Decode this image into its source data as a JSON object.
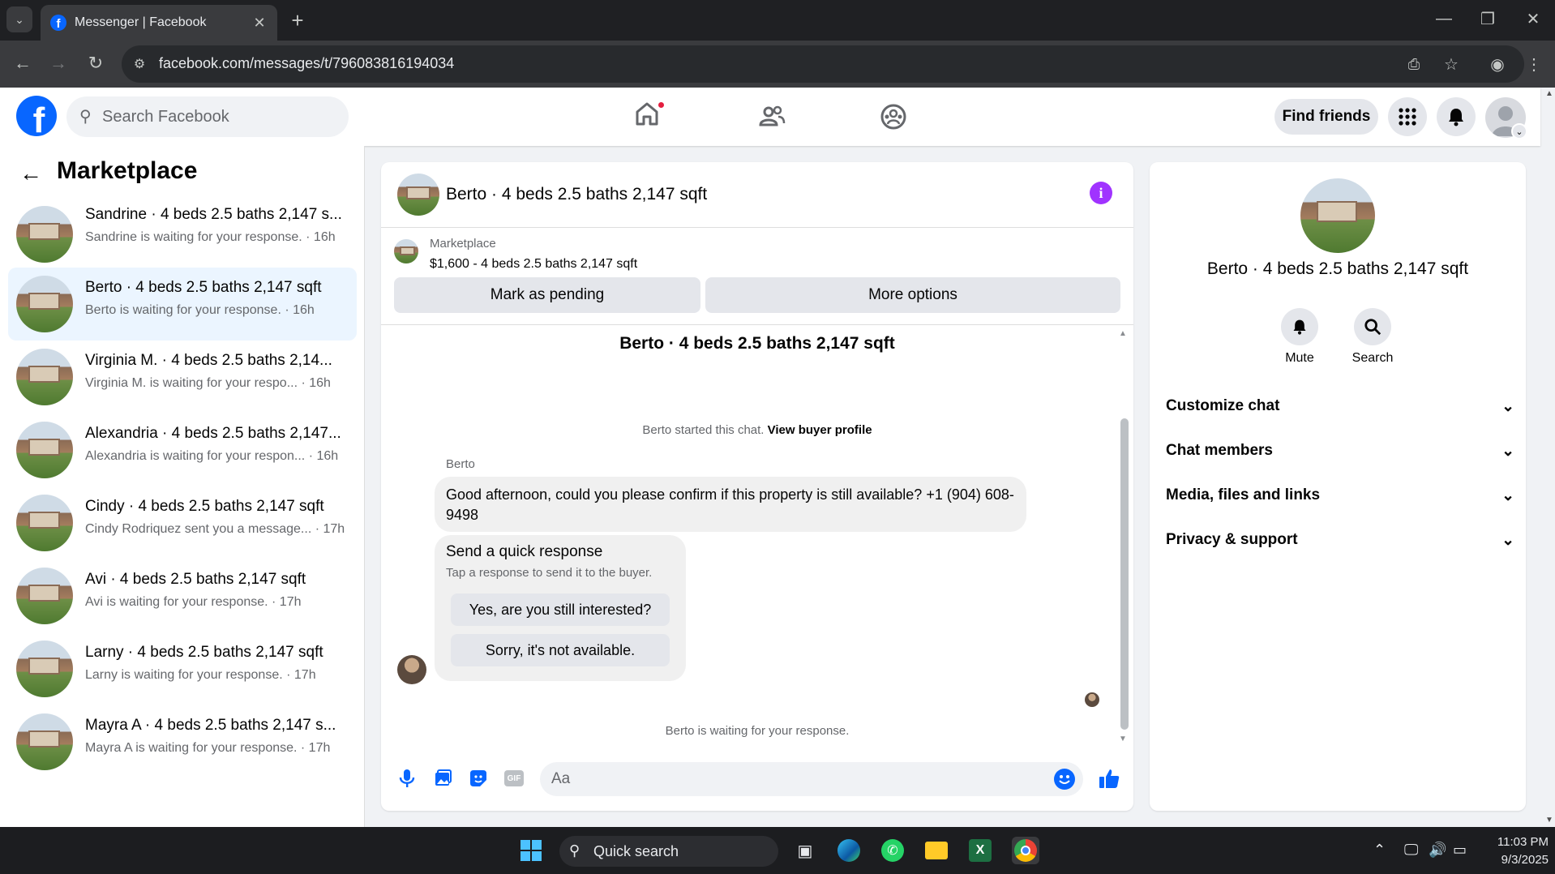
{
  "browser": {
    "tab_title": "Messenger | Facebook",
    "url": "facebook.com/messages/t/796083816194034"
  },
  "header": {
    "search_placeholder": "Search Facebook",
    "find_friends": "Find friends"
  },
  "sidebar": {
    "title": "Marketplace",
    "items": [
      {
        "name": "Sandrine · 4 beds 2.5 baths 2,147 s...",
        "preview": "Sandrine is waiting for your response. · 16h",
        "selected": false
      },
      {
        "name": "Berto · 4 beds 2.5 baths 2,147 sqft",
        "preview": "Berto is waiting for your response. · 16h",
        "selected": true
      },
      {
        "name": "Virginia M. · 4 beds 2.5 baths 2,14...",
        "preview": "Virginia M. is waiting for your respo... · 16h",
        "selected": false
      },
      {
        "name": "Alexandria · 4 beds 2.5 baths 2,147...",
        "preview": "Alexandria is waiting for your respon... · 16h",
        "selected": false
      },
      {
        "name": "Cindy · 4 beds 2.5 baths 2,147 sqft",
        "preview": "Cindy Rodriquez sent you a message... · 17h",
        "selected": false
      },
      {
        "name": "Avi · 4 beds 2.5 baths 2,147 sqft",
        "preview": "Avi is waiting for your response. · 17h",
        "selected": false
      },
      {
        "name": "Larny · 4 beds 2.5 baths 2,147 sqft",
        "preview": "Larny is waiting for your response. · 17h",
        "selected": false
      },
      {
        "name": "Mayra A · 4 beds 2.5 baths 2,147 s...",
        "preview": "Mayra A is waiting for your response. · 17h",
        "selected": false
      }
    ]
  },
  "chat": {
    "title": "Berto · 4 beds 2.5 baths 2,147 sqft",
    "listing_source": "Marketplace",
    "listing_price": "$1,600 - 4 beds 2.5 baths 2,147 sqft",
    "mark_pending": "Mark as pending",
    "more_options": "More options",
    "intro_title": "Berto · 4 beds 2.5 baths 2,147 sqft",
    "started_text": "Berto started this chat.",
    "view_profile": "View buyer profile",
    "sender": "Berto",
    "message": "Good afternoon, could you please confirm if this property is still available? +1 (904) 608-9498",
    "quick_title": "Send a quick response",
    "quick_sub": "Tap a response to send it to the buyer.",
    "quick_1": "Yes, are you still interested?",
    "quick_2": "Sorry, it's not available.",
    "waiting": "Berto is waiting for your response.",
    "composer_placeholder": "Aa"
  },
  "right_panel": {
    "title": "Berto · 4 beds 2.5 baths 2,147 sqft",
    "mute": "Mute",
    "search": "Search",
    "sections": [
      "Customize chat",
      "Chat members",
      "Media, files and links",
      "Privacy & support"
    ]
  },
  "taskbar": {
    "search": "Quick search",
    "time": "11:03 PM",
    "date": "9/3/2025"
  },
  "colors": {
    "brand": "#0866ff",
    "accent_purple": "#a033ff",
    "notification": "#e41e3f"
  }
}
